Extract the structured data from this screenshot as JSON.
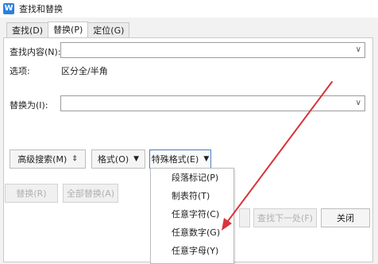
{
  "window": {
    "title": "查找和替换",
    "app_icon_letter": "W"
  },
  "tabs": [
    {
      "label": "查找(D)"
    },
    {
      "label": "替换(P)"
    },
    {
      "label": "定位(G)"
    }
  ],
  "find": {
    "label": "查找内容(N):",
    "value": ""
  },
  "options": {
    "label": "选项:",
    "value": "区分全/半角"
  },
  "replace": {
    "label": "替换为(I):",
    "value": ""
  },
  "buttons": {
    "advanced_search": "高级搜索(M)",
    "format": "格式(O)",
    "special_format": "特殊格式(E)",
    "replace": "替换(R)",
    "replace_all": "全部替换(A)",
    "find_next": "查找下一处(F)",
    "close": "关闭"
  },
  "special_menu": [
    {
      "label": "段落标记(P)"
    },
    {
      "label": "制表符(T)"
    },
    {
      "label": "任意字符(C)"
    },
    {
      "label": "任意数字(G)"
    },
    {
      "label": "任意字母(Y)"
    }
  ],
  "glyphs": {
    "chevron": "∨",
    "double_caret": "⇕",
    "caret": "▼"
  },
  "colors": {
    "accent_arrow": "#d9343a",
    "app_icon": "#2b7fe0",
    "focus_border": "#4a7fc0"
  }
}
